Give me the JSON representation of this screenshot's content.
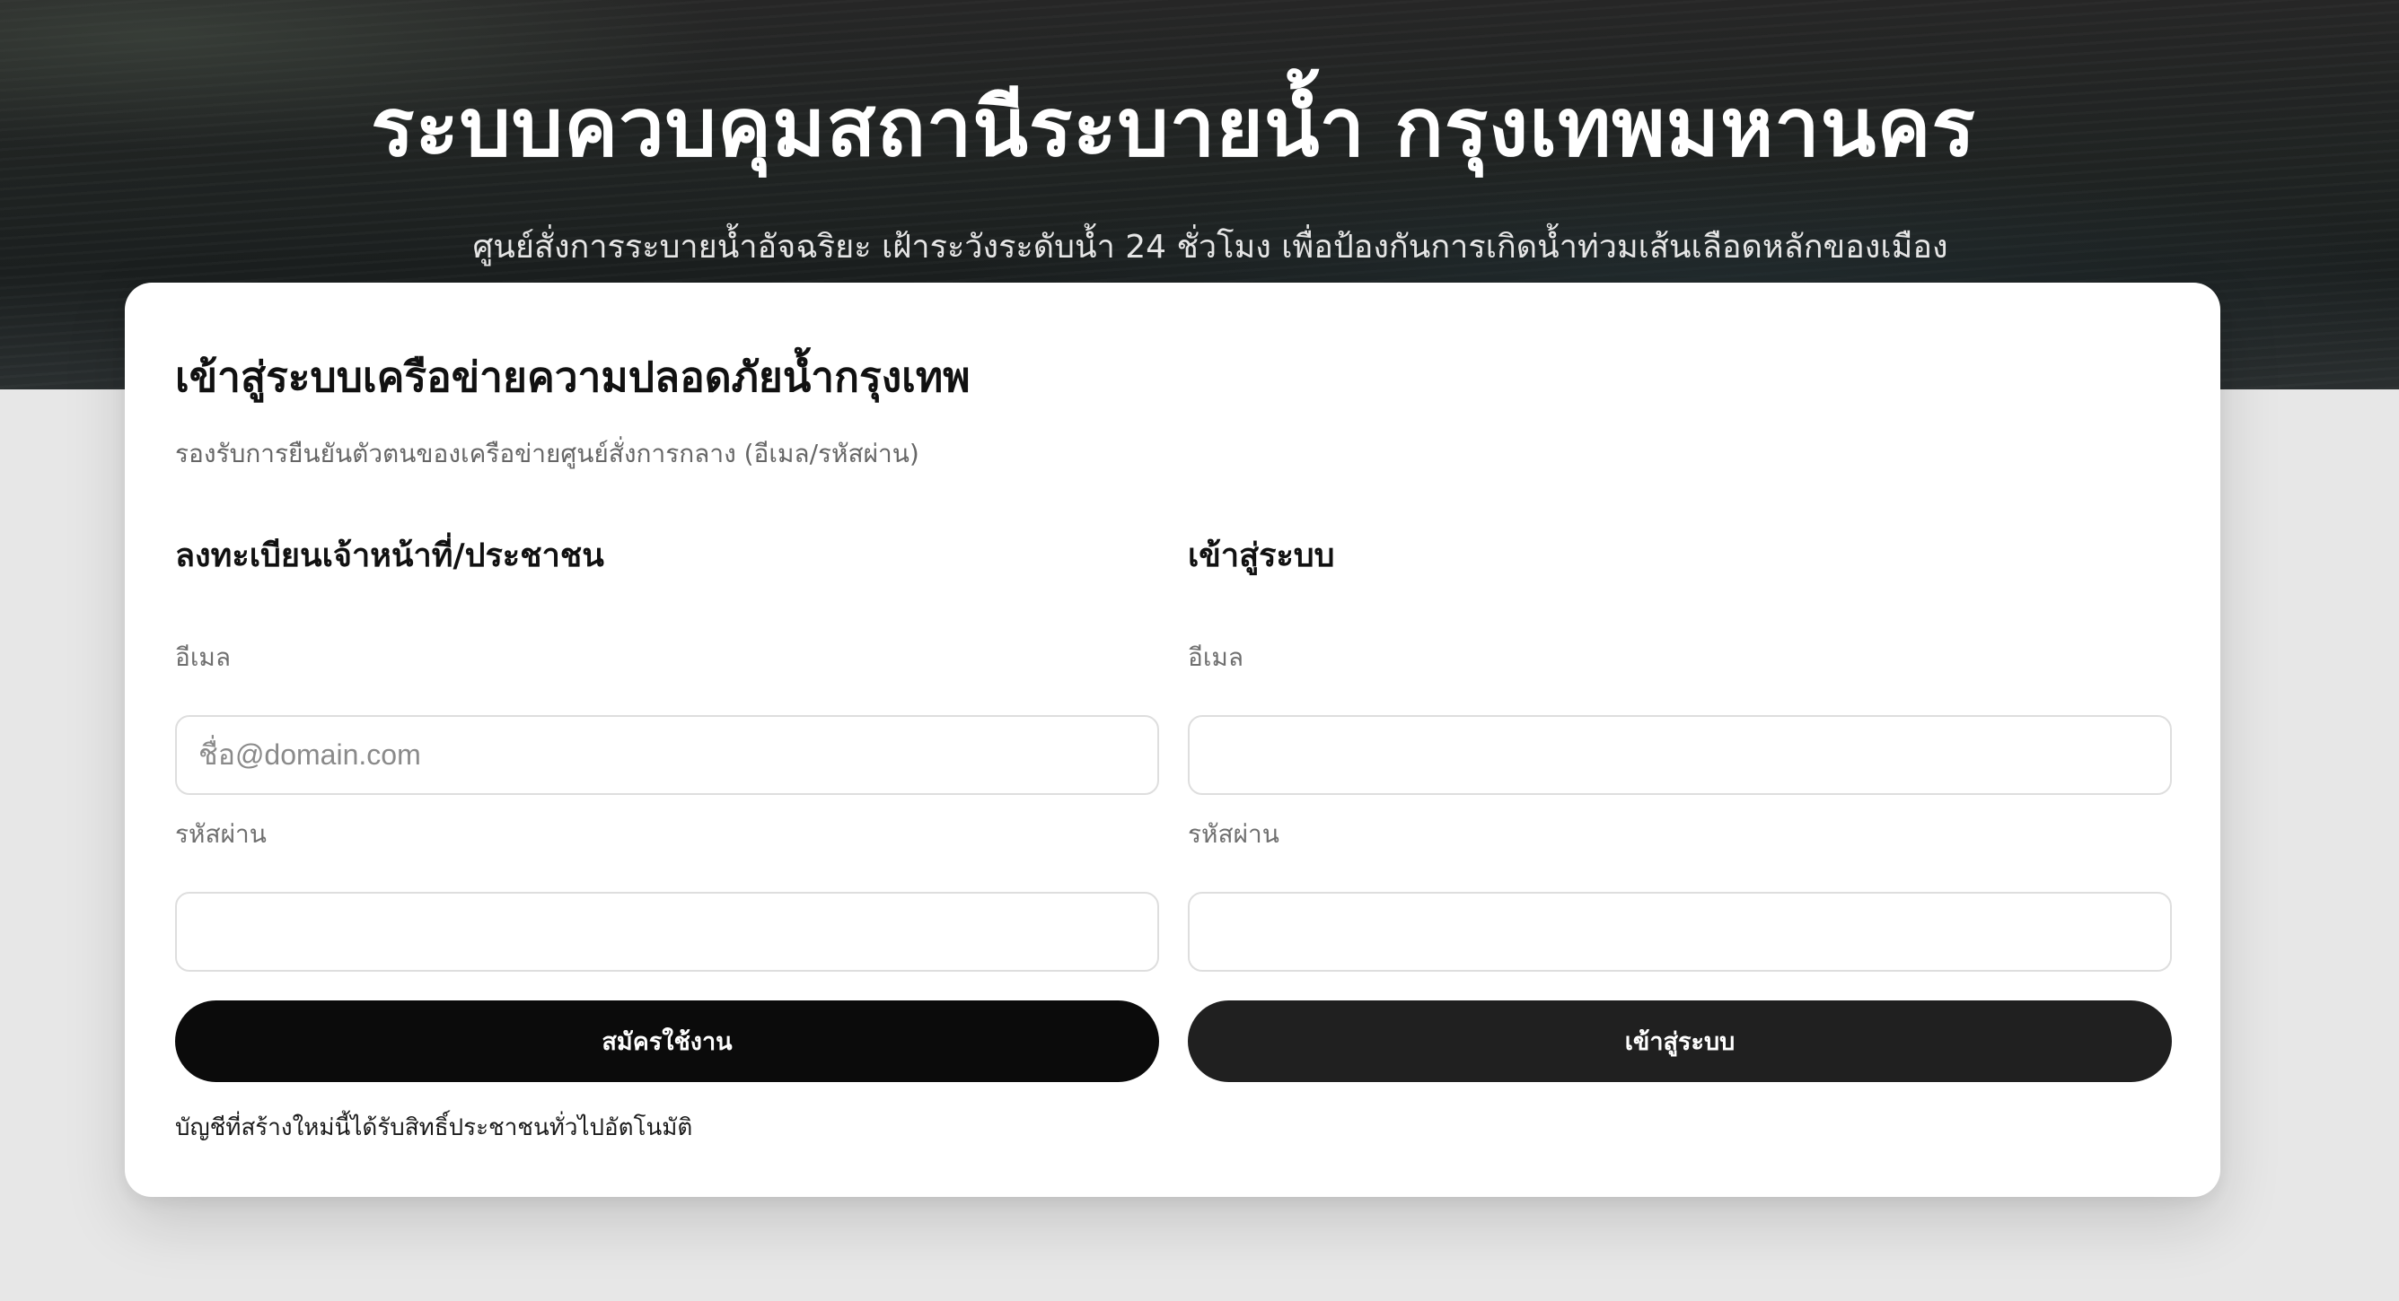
{
  "hero": {
    "title": "ระบบควบคุมสถานีระบายน้ำ กรุงเทพมหานคร",
    "subtitle": "ศูนย์สั่งการระบายน้ำอัจฉริยะ เฝ้าระวังระดับน้ำ 24 ชั่วโมง เพื่อป้องกันการเกิดน้ำท่วมเส้นเลือดหลักของเมือง"
  },
  "card": {
    "title": "เข้าสู่ระบบเครือข่ายความปลอดภัยน้ำกรุงเทพ",
    "subtitle": "รองรับการยืนยันตัวตนของเครือข่ายศูนย์สั่งการกลาง (อีเมล/รหัสผ่าน)"
  },
  "register": {
    "heading": "ลงทะเบียนเจ้าหน้าที่/ประชาชน",
    "email_label": "อีเมล",
    "email_placeholder": "ชื่อ@domain.com",
    "email_value": "",
    "password_label": "รหัสผ่าน",
    "password_value": "",
    "button_label": "สมัครใช้งาน",
    "note": "บัญชีที่สร้างใหม่นี้ได้รับสิทธิ์ประชาชนทั่วไปอัตโนมัติ"
  },
  "login": {
    "heading": "เข้าสู่ระบบ",
    "email_label": "อีเมล",
    "email_value": "",
    "password_label": "รหัสผ่าน",
    "password_value": "",
    "button_label": "เข้าสู่ระบบ"
  },
  "colors": {
    "background": "#e7e7e7",
    "hero": "#1f2322",
    "card": "#ffffff",
    "register_button": "#0b0b0b",
    "login_button": "#202020"
  }
}
